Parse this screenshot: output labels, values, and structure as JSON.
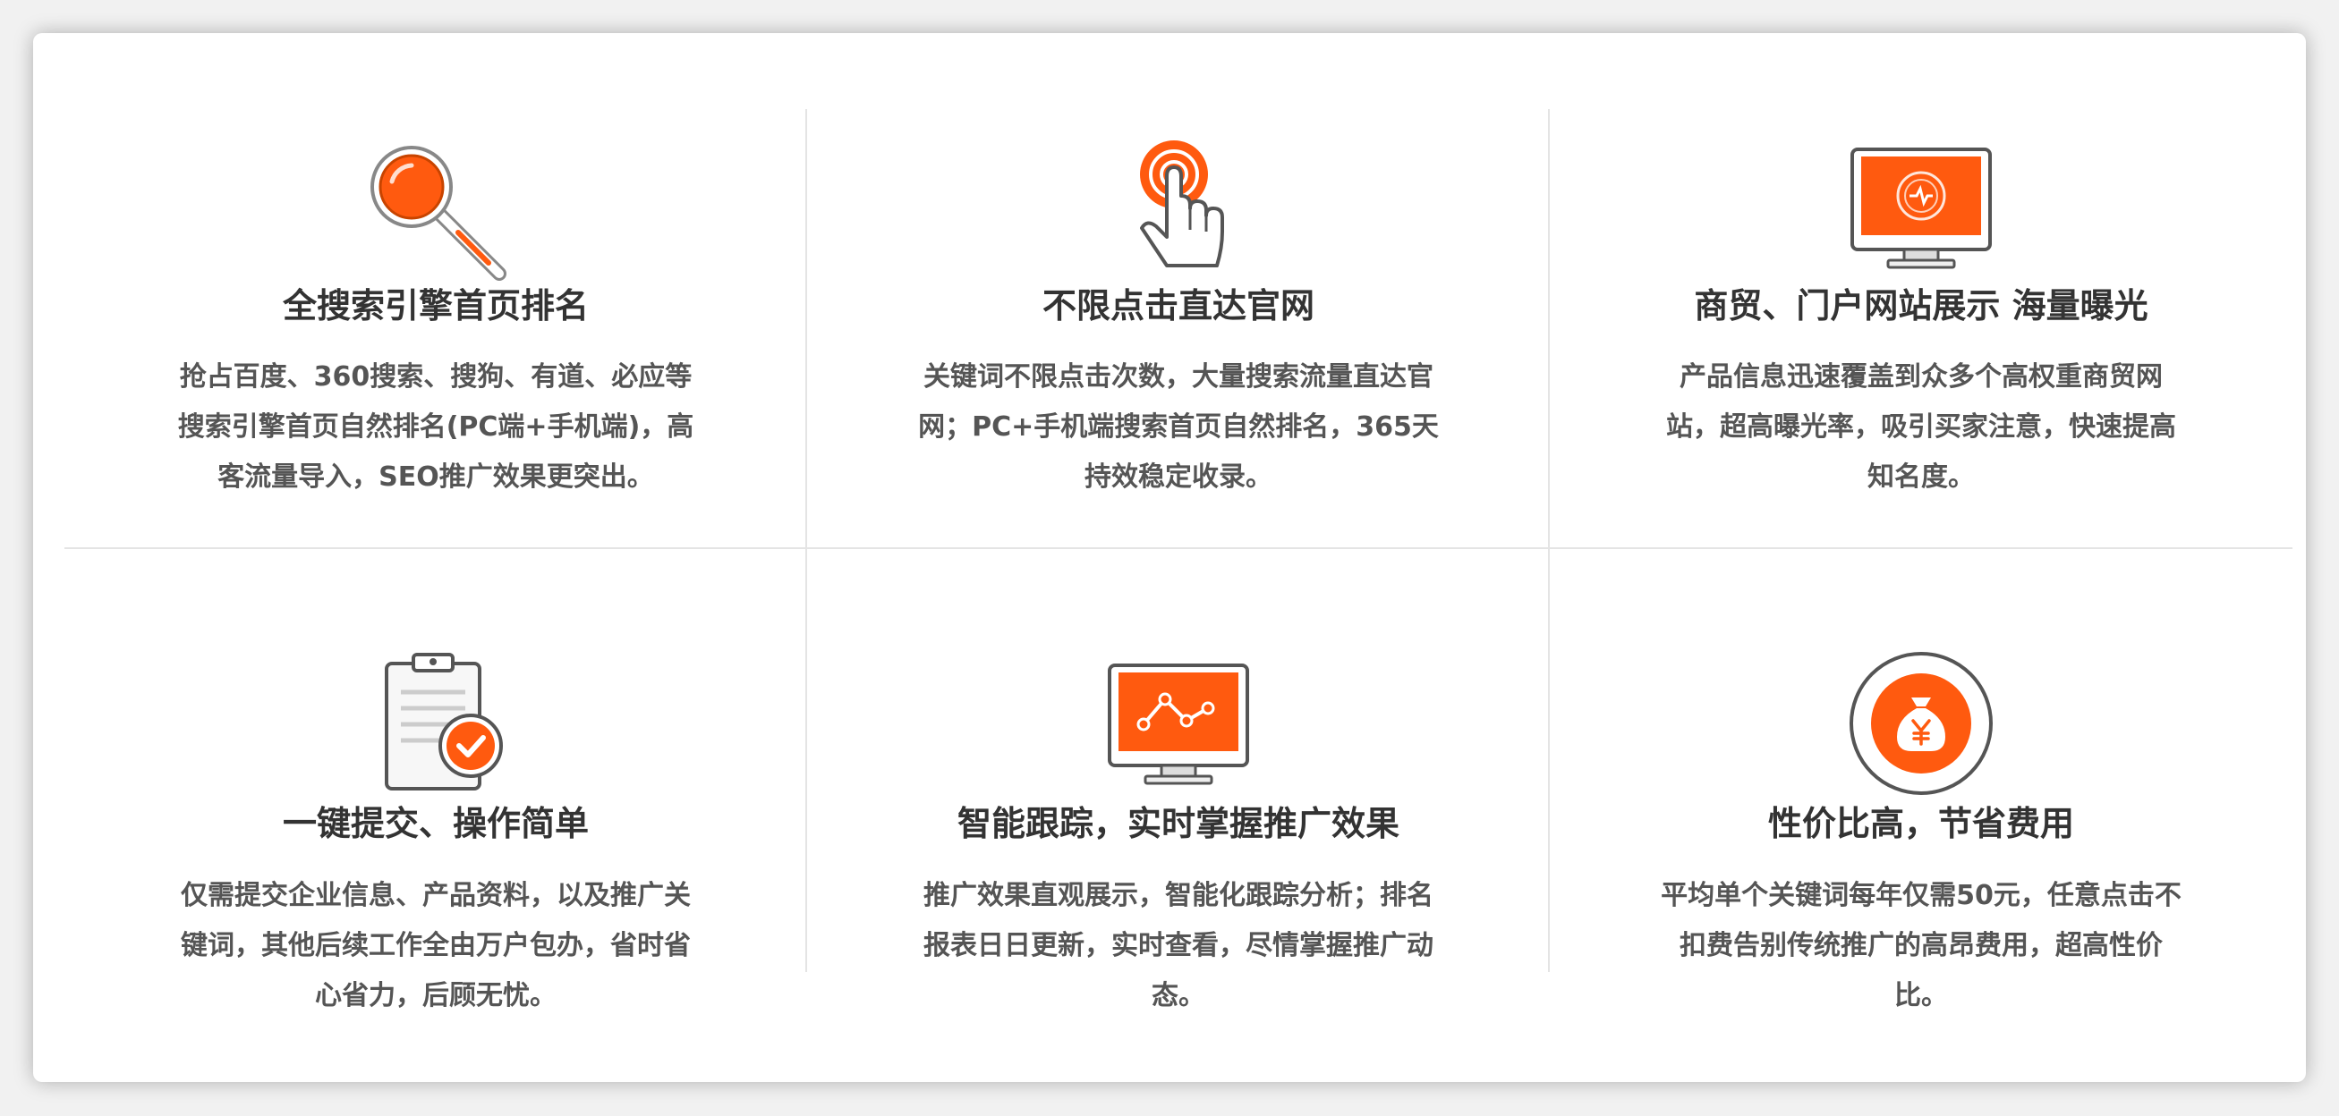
{
  "theme": {
    "accent": "#ff5a0f",
    "title_color": "#333333",
    "text_color": "#555555",
    "divider": "#e4e4e4"
  },
  "features": [
    {
      "icon": "magnifier-icon",
      "title": "全搜索引擎首页排名",
      "desc": "抢占百度、360搜索、搜狗、有道、必应等搜索引擎首页自然排名(PC端+手机端)，高客流量导入，SEO推广效果更突出。"
    },
    {
      "icon": "tap-hand-icon",
      "title": "不限点击直达官网",
      "desc": "关键词不限点击次数，大量搜索流量直达官网；PC+手机端搜索首页自然排名，365天持效稳定收录。"
    },
    {
      "icon": "monitor-display-icon",
      "title": "商贸、门户网站展示 海量曝光",
      "desc": "产品信息迅速覆盖到众多个高权重商贸网站，超高曝光率，吸引买家注意，快速提高知名度。"
    },
    {
      "icon": "clipboard-check-icon",
      "title": "一键提交、操作简单",
      "desc": "仅需提交企业信息、产品资料，以及推广关键词，其他后续工作全由万户包办，省时省心省力，后顾无忧。"
    },
    {
      "icon": "monitor-chart-icon",
      "title": "智能跟踪，实时掌握推广效果",
      "desc": "推广效果直观展示，智能化跟踪分析；排名报表日日更新，实时查看，尽情掌握推广动态。"
    },
    {
      "icon": "money-bag-icon",
      "title": "性价比高，节省费用",
      "desc": "平均单个关键词每年仅需50元，任意点击不扣费告别传统推广的高昂费用，超高性价比。"
    }
  ]
}
